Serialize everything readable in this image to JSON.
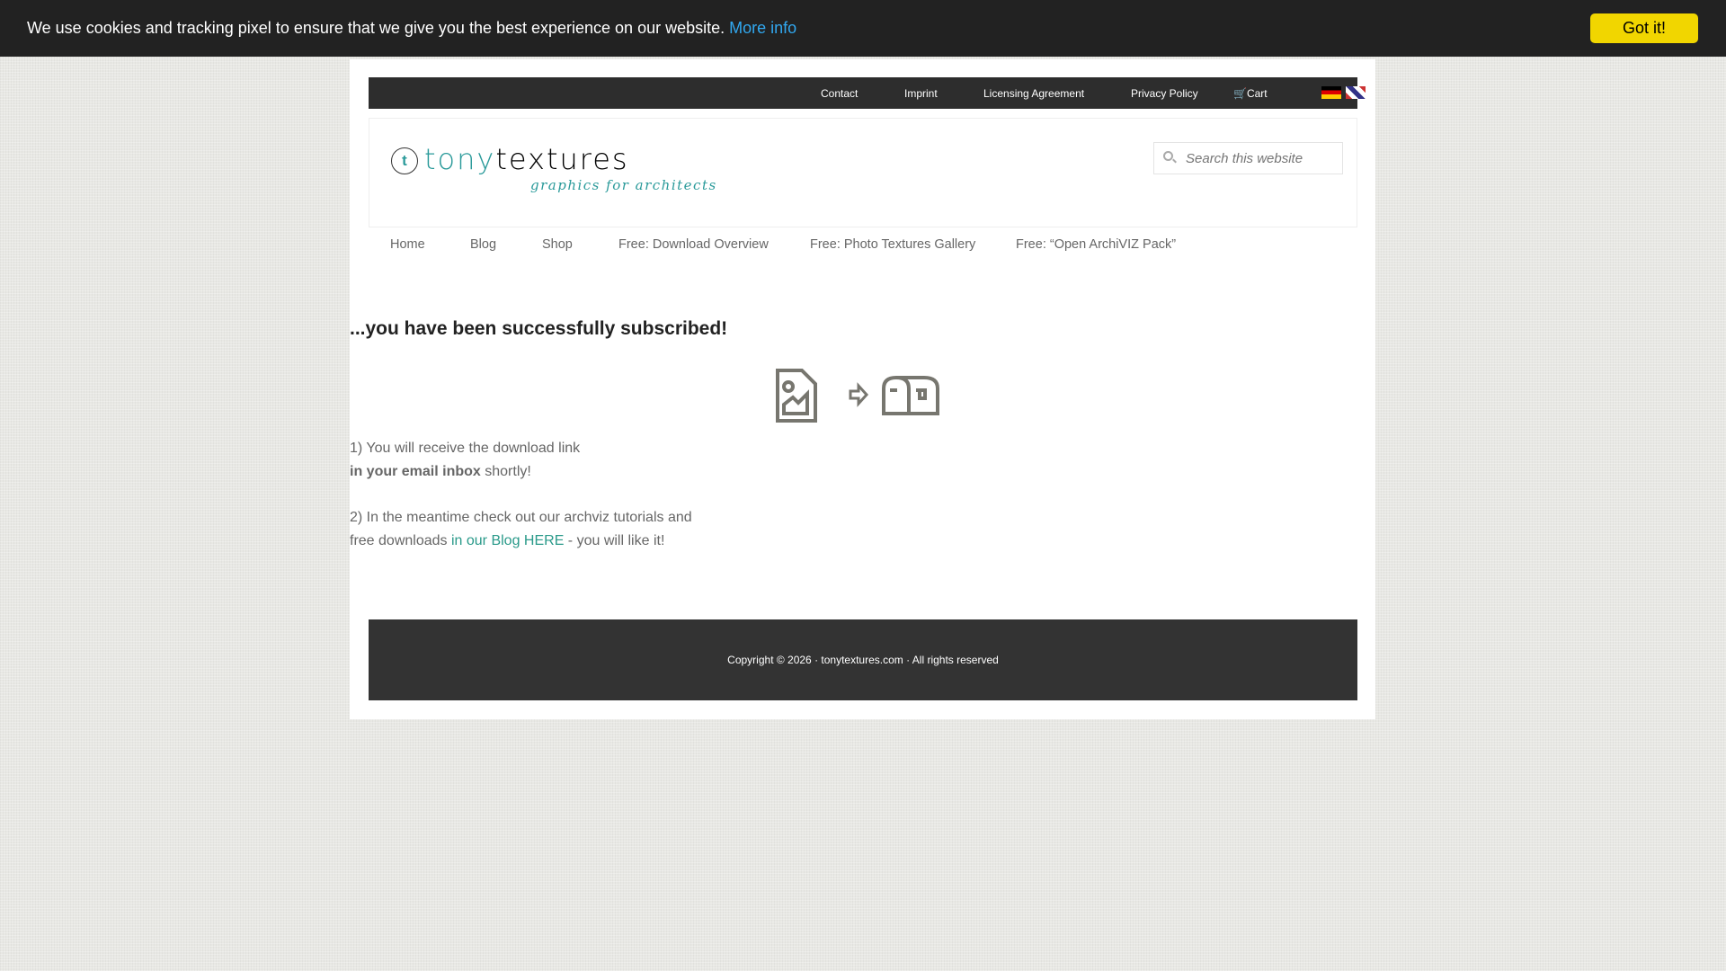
{
  "cookie": {
    "message": "We use cookies and tracking pixel to ensure that we give you the best experience on our website.",
    "more_info": "More info",
    "button": "Got it!"
  },
  "topbar": {
    "links": [
      "Contact",
      "Imprint",
      "Licensing Agreement",
      "Privacy Policy"
    ],
    "cart": "Cart",
    "flags": [
      "german-flag",
      "english-flag"
    ]
  },
  "logo": {
    "name_a": "tony",
    "name_b": "textures",
    "tagline": "graphics for architects",
    "mark": "t"
  },
  "search": {
    "placeholder": "Search this website"
  },
  "nav": [
    "Home",
    "Blog",
    "Shop",
    "Free: Download Overview",
    "Free: Photo Textures Gallery",
    "Free: “Open ArchiVIZ Pack”"
  ],
  "main": {
    "heading": "...you have been successfully subscribed!",
    "line1": "1) You will receive the download link",
    "line2_bold": "in your email inbox",
    "line2_rest": " shortly!",
    "line3": "2) In the meantime check out our archviz tutorials and",
    "line4_pre": "free downloads ",
    "line4_link": "in our Blog HERE",
    "line4_post": " - you will like it!"
  },
  "footer": {
    "text": "Copyright © 2026 · tonytextures.com · All rights reserved"
  },
  "colors": {
    "accent": "#2a9a8a",
    "cookie_button": "#f1d600",
    "dark": "#2d2d2d"
  }
}
